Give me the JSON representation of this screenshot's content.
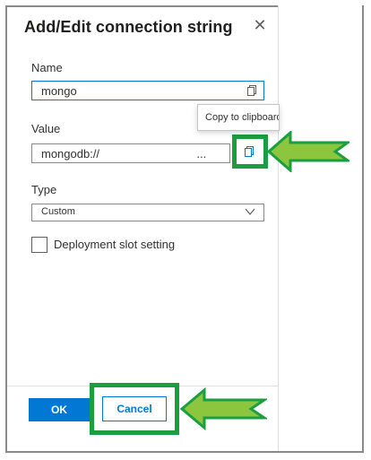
{
  "dialog": {
    "title": "Add/Edit connection string",
    "close_glyph": "✕"
  },
  "fields": {
    "name": {
      "label": "Name",
      "value": "mongo"
    },
    "value": {
      "label": "Value",
      "value": "mongodb://                              ..."
    },
    "type": {
      "label": "Type",
      "selected": "Custom"
    },
    "deployment_slot": {
      "label": "Deployment slot setting",
      "checked": false
    }
  },
  "tooltip": {
    "text": "Copy to clipboard"
  },
  "footer": {
    "ok_label": "OK",
    "cancel_label": "Cancel"
  },
  "icons": {
    "copy": "copy-icon",
    "close": "close-icon",
    "chevron": "chevron-down-icon",
    "arrow": "arrow-left-icon"
  },
  "colors": {
    "primary": "#0078d4",
    "highlight": "#1a9e3f",
    "arrow_fill": "#8cc63f"
  }
}
